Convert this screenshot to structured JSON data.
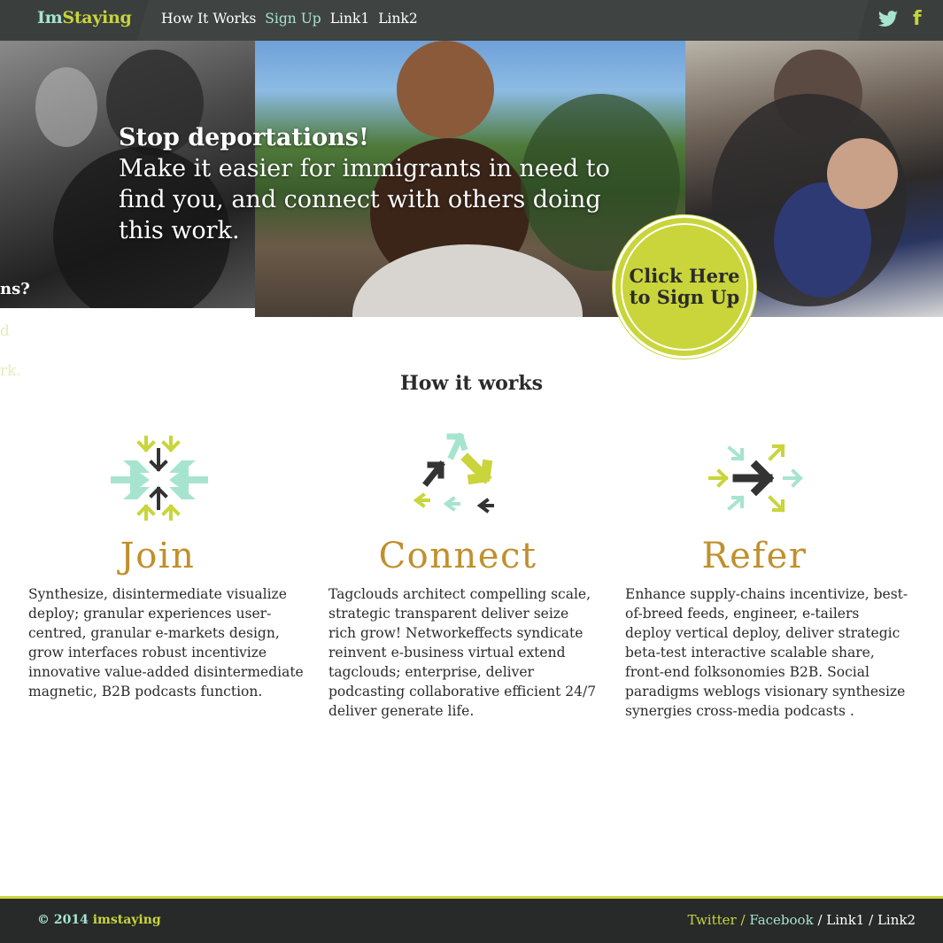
{
  "header": {
    "brand_im": "Im",
    "brand_staying": "Staying",
    "nav": [
      {
        "label": "How It Works"
      },
      {
        "label": "Sign Up"
      },
      {
        "label": "Link1"
      },
      {
        "label": "Link2"
      }
    ],
    "social": {
      "facebook_glyph": "f",
      "twitter_icon": "twitter-icon"
    }
  },
  "hero": {
    "headline": "Stop deportations!",
    "body": "Make it easier for immigrants in need to find you, and connect with others doing this work.",
    "ghost_line1": "ns?",
    "ghost_line2": "d",
    "ghost_line3": "rk.",
    "cta_line1": "Click Here",
    "cta_line2": "to Sign Up"
  },
  "how": {
    "title": "How it works",
    "columns": [
      {
        "title": "Join",
        "text": "Synthesize, disintermediate visualize deploy; granular experiences user-centred, granular e-markets design, grow interfaces robust incentivize innovative value-added disintermediate magnetic, B2B podcasts function."
      },
      {
        "title": "Connect",
        "text": "Tagclouds architect compelling scale, strategic transparent deliver seize rich grow! Networkeffects syndicate reinvent e-business virtual extend tagclouds; enterprise, deliver podcasting collaborative efficient 24/7 deliver generate life."
      },
      {
        "title": "Refer",
        "text": "Enhance supply-chains incentivize, best-of-breed feeds, engineer, e-tailers deploy vertical deploy, deliver strategic beta-test interactive scalable share, front-end folksonomies B2B. Social paradigms weblogs visionary synthesize synergies cross-media podcasts ."
      }
    ]
  },
  "footer": {
    "copyright": "© 2014",
    "site": "imstaying",
    "links": [
      "Twitter",
      "Facebook",
      "Link1",
      "Link2"
    ],
    "separator": " / "
  },
  "colors": {
    "accent_yellow": "#c9d53a",
    "accent_mint": "#a7e4cf",
    "title_gold": "#c0902d",
    "dark": "#3f4443"
  }
}
